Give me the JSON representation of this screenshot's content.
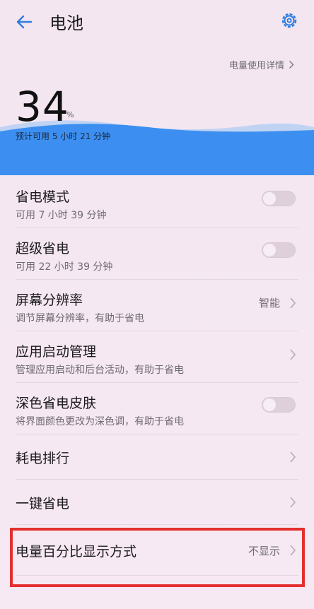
{
  "header": {
    "title": "电池"
  },
  "detail_link": "电量使用详情",
  "battery": {
    "percent": "34",
    "percent_sign": "%",
    "remaining": "预计可用 5 小时 21 分钟"
  },
  "colors": {
    "accent": "#2d8cf0",
    "highlight": "#e3302f"
  },
  "items": [
    {
      "title": "省电模式",
      "subtitle": "可用 7 小时 39 分钟",
      "control": "toggle",
      "on": false
    },
    {
      "title": "超级省电",
      "subtitle": "可用 22 小时 39 分钟",
      "control": "toggle",
      "on": false
    },
    {
      "title": "屏幕分辨率",
      "subtitle": "调节屏幕分辨率，有助于省电",
      "value": "智能",
      "control": "chevron"
    },
    {
      "title": "应用启动管理",
      "subtitle": "管理应用启动和后台活动，有助于省电",
      "control": "chevron"
    },
    {
      "title": "深色省电皮肤",
      "subtitle": "将界面颜色更改为深色调，有助于省电",
      "control": "toggle",
      "on": false
    },
    {
      "title": "耗电排行",
      "control": "chevron"
    },
    {
      "title": "一键省电",
      "control": "chevron"
    },
    {
      "title": "电量百分比显示方式",
      "value": "不显示",
      "control": "chevron"
    }
  ]
}
